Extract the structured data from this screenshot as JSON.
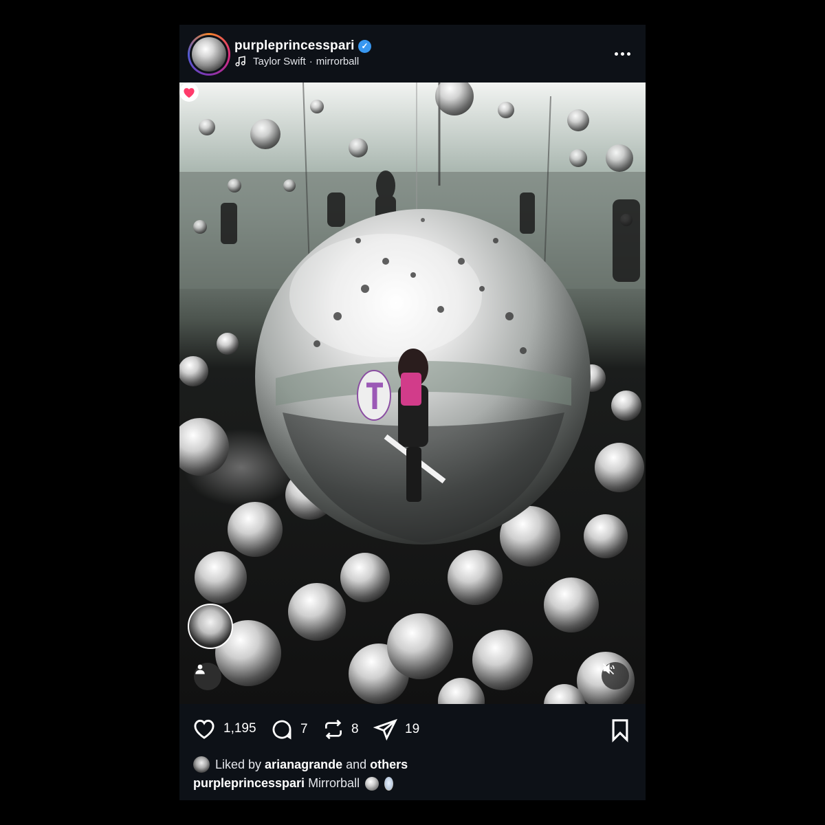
{
  "post": {
    "username": "purpleprincesspari",
    "verified_icon": "verified-badge-icon",
    "music": {
      "artist": "Taylor Swift",
      "separator": "·",
      "track": "mirrorball",
      "icon": "music-note-icon"
    },
    "more_icon": "more-options-icon",
    "media": {
      "type": "reel",
      "overlay_icons": [
        "user-tag-icon",
        "muted-speaker-icon",
        "heart-icon"
      ]
    },
    "actions": {
      "likes": "1,195",
      "comments": "7",
      "reposts": "8",
      "shares": "19"
    },
    "liked_by": {
      "prefix": "Liked by",
      "user": "arianagrande",
      "conjunction": "and",
      "others": "others"
    },
    "caption": {
      "username": "purpleprincesspari",
      "text": "Mirrorball"
    },
    "colors": {
      "background": "#0d1117",
      "verified": "#3897f0",
      "heart_badge": "#ff3b6b"
    }
  }
}
